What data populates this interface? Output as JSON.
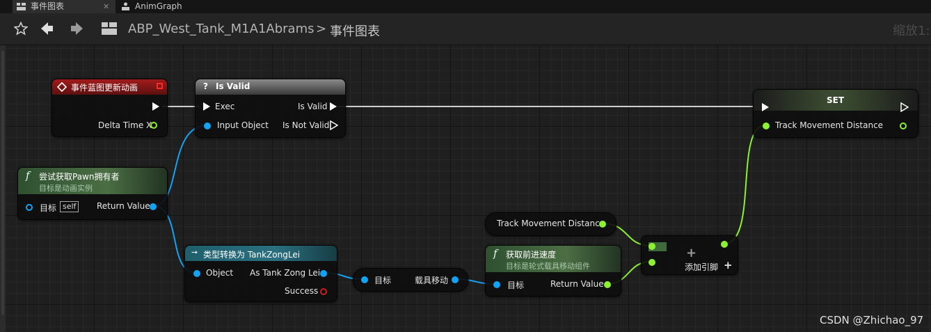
{
  "tabs": [
    {
      "label": "事件图表",
      "icon": "event-graph-icon",
      "active": true
    },
    {
      "label": "AnimGraph",
      "icon": "anim-graph-icon",
      "active": false
    }
  ],
  "toolbar": {
    "breadcrumb": [
      "ABP_West_Tank_M1A1Abrams",
      "事件图表"
    ],
    "separator": ">",
    "zoom_label": "缩放1:"
  },
  "nodes": {
    "event": {
      "title": "事件蓝图更新动画",
      "pin_delta": "Delta Time X"
    },
    "is_valid": {
      "icon_glyph": "?",
      "title": "Is Valid",
      "pin_exec": "Exec",
      "pin_input": "Input Object",
      "pin_is_valid": "Is Valid",
      "pin_is_not_valid": "Is Not Valid"
    },
    "set": {
      "title": "SET",
      "pin_value": "Track Movement Distance"
    },
    "pawn_owner": {
      "icon_glyph": "f",
      "title": "尝试获取Pawn拥有者",
      "subtitle": "目标是动画实例",
      "pin_target": "目标",
      "pin_target_default": "self",
      "pin_return": "Return Value"
    },
    "get_track": {
      "label": "Track Movement Distance"
    },
    "add": {
      "plus": "+",
      "add_pin_label": "添加引脚",
      "add_pin_plus": "+"
    },
    "cast": {
      "title": "类型转换为 TankZongLei",
      "pin_object": "Object",
      "pin_as": "As Tank Zong Lei",
      "pin_success": "Success"
    },
    "vehicle_move": {
      "pin_target": "目标",
      "pin_out": "载具移动"
    },
    "forward_speed": {
      "icon_glyph": "f",
      "title": "获取前进速度",
      "subtitle": "目标是轮式载具移动组件",
      "pin_target": "目标",
      "pin_return": "Return Value"
    }
  },
  "watermark": "CSDN @Zhichao_97",
  "colors": {
    "exec": "#ffffff",
    "object": "#14a3f2",
    "float": "#8ef034",
    "bool": "#c8201a",
    "event_header": "#8c1414",
    "function_header": "#3f6b3a",
    "cast_header": "#1c5a66",
    "macro_header": "#666666"
  }
}
